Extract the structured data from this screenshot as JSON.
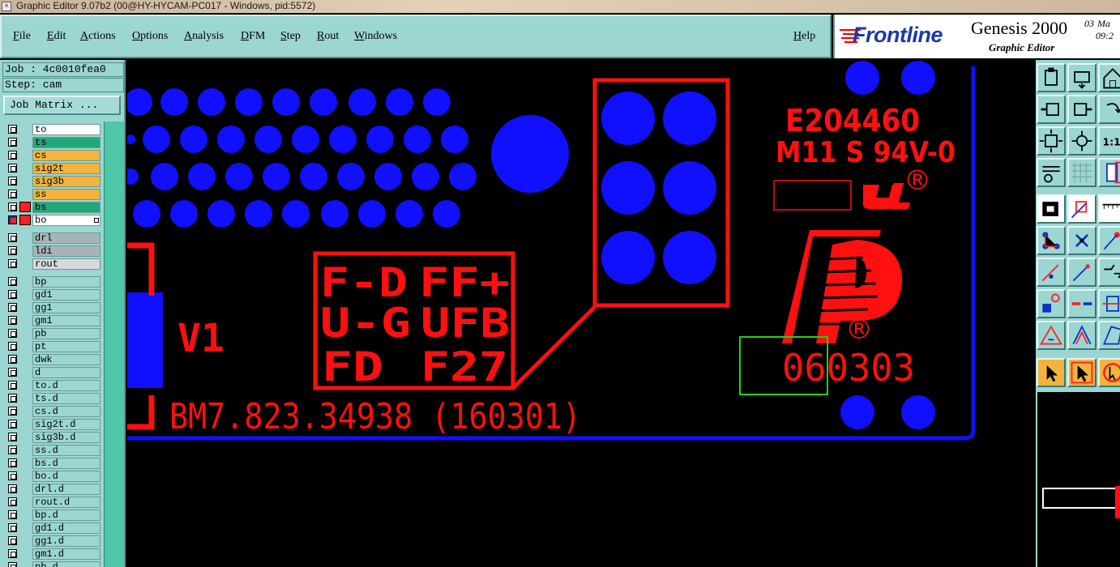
{
  "window": {
    "title": "Graphic Editor 9.07b2 (00@HY-HYCAM-PC017 - Windows, pid:5572)"
  },
  "menu": {
    "items": [
      "File",
      "Edit",
      "Actions",
      "Options",
      "Analysis",
      "DFM",
      "Step",
      "Rout",
      "Windows"
    ],
    "help": "Help"
  },
  "logo": {
    "brand": "Frontline",
    "product": "Genesis 2000",
    "subtitle": "Graphic Editor",
    "date_day": "03",
    "date_month": "Ma",
    "time": "09:2"
  },
  "job_panel": {
    "job_label": "Job : 4c0010fea0",
    "step_label": "Step: cam",
    "job_matrix_button": "Job Matrix ..."
  },
  "layers": {
    "group1": [
      {
        "name": "to",
        "color": "#ffffff"
      },
      {
        "name": "ts",
        "color": "#22a878"
      },
      {
        "name": "cs",
        "color": "#f2b43c"
      },
      {
        "name": "sig2t",
        "color": "#f2b43c"
      },
      {
        "name": "sig3b",
        "color": "#f2b43c"
      },
      {
        "name": "ss",
        "color": "#f2b43c"
      },
      {
        "name": "bs",
        "color": "#22a878",
        "affected": true
      },
      {
        "name": "bo",
        "color": "#ffffff",
        "work": true
      }
    ],
    "group2": [
      {
        "name": "drl",
        "color": "#a8b4b8"
      },
      {
        "name": "ldi",
        "color": "#a8b4b8"
      },
      {
        "name": "rout",
        "color": "#d8d8d8"
      }
    ],
    "group3": [
      {
        "name": "bp"
      },
      {
        "name": "gd1"
      },
      {
        "name": "gg1"
      },
      {
        "name": "gm1"
      },
      {
        "name": "pb"
      },
      {
        "name": "pt"
      },
      {
        "name": "dwk"
      },
      {
        "name": "d"
      },
      {
        "name": "to.d"
      },
      {
        "name": "ts.d"
      },
      {
        "name": "cs.d"
      },
      {
        "name": "sig2t.d"
      },
      {
        "name": "sig3b.d"
      },
      {
        "name": "ss.d"
      },
      {
        "name": "bs.d"
      },
      {
        "name": "bo.d"
      },
      {
        "name": "drl.d"
      },
      {
        "name": "rout.d"
      },
      {
        "name": "bp.d"
      },
      {
        "name": "gd1.d"
      },
      {
        "name": "gg1.d"
      },
      {
        "name": "gm1.d"
      },
      {
        "name": "pb.d"
      }
    ]
  },
  "board": {
    "cert_id": "E204460",
    "material_grade": "M11 S 94V-0",
    "registered_mark": "®",
    "date_code": "060303",
    "part_number": "BM7.823.34938 (160301)",
    "ref_designator": "V1",
    "pin_labels": [
      "F-D",
      "FF+",
      "U-G",
      "UFB",
      "FD",
      "F27"
    ],
    "colors": {
      "pad": "#1010ff",
      "silk": "#ff1010",
      "highlight": "#20d020"
    }
  },
  "toolbar": {
    "icons": [
      "zoom-home-icon",
      "zoom-window-icon",
      "home-icon",
      "zoom-back-icon",
      "zoom-forward-icon",
      "refresh-icon",
      "fit-screen-icon",
      "fit-profile-icon",
      "scale-1to1-icon",
      "measure-icon",
      "grid-icon",
      "snap-icon",
      "feature-select-icon",
      "edit-shape-icon",
      "ruler-icon",
      "connect-icon",
      "delete-icon",
      "network-icon",
      "line-icon",
      "draw-line-icon",
      "route-icon",
      "pad-icon",
      "cut-icon",
      "align-icon",
      "triangle-icon",
      "angle-icon",
      "polygon-icon",
      "pointer-icon",
      "select-box-icon",
      "rotate-icon"
    ]
  }
}
